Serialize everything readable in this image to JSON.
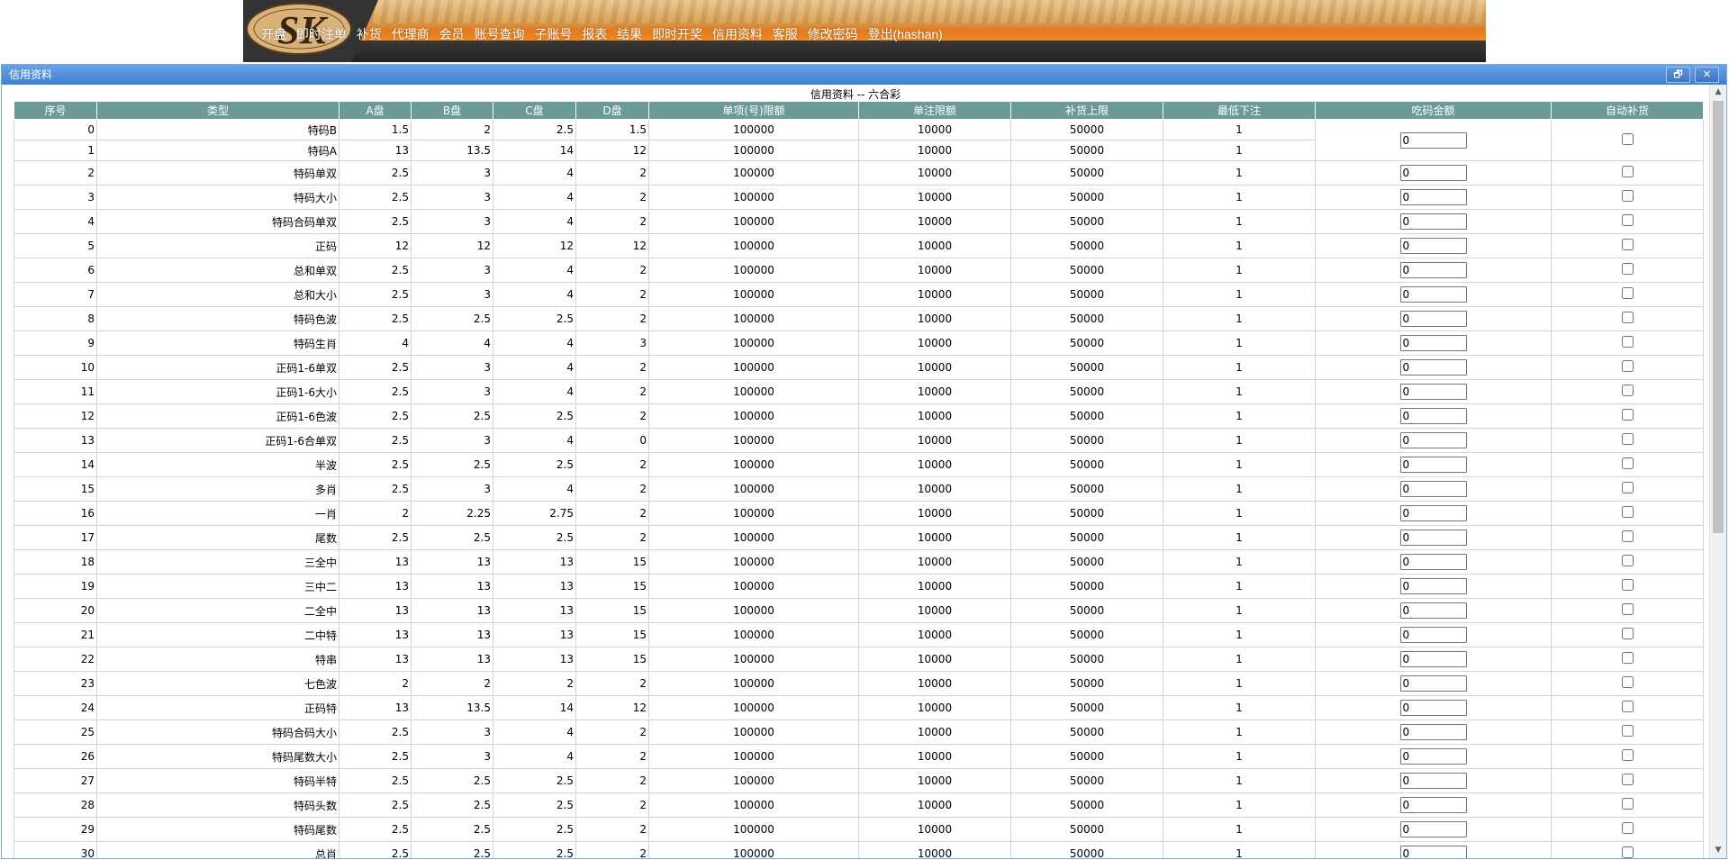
{
  "nav": {
    "logo_text": "SK",
    "items": [
      "开盘",
      "即时注单",
      "补货",
      "代理商",
      "会员",
      "账号查询",
      "子账号",
      "报表",
      "结果",
      "即时开奖",
      "信用资料",
      "客服",
      "修改密码",
      "登出(hashan)"
    ]
  },
  "window": {
    "title": "信用资料",
    "restore_symbol": "🗗",
    "close_symbol": "✕"
  },
  "page": {
    "heading": "信用资料 -- 六合彩"
  },
  "scrollbar": {
    "up_symbol": "▲",
    "down_symbol": "▼"
  },
  "table": {
    "headers": [
      "序号",
      "类型",
      "A盘",
      "B盘",
      "C盘",
      "D盘",
      "单项(号)限额",
      "单注限额",
      "补货上限",
      "最低下注",
      "吃码金额",
      "自动补货"
    ],
    "rows": [
      {
        "no": "0",
        "type": "特码B",
        "a": "1.5",
        "b": "2",
        "c": "2.5",
        "d": "1.5",
        "item_limit": "100000",
        "bet_limit": "10000",
        "hedge_limit": "50000",
        "min_bet": "1",
        "eat": "0"
      },
      {
        "no": "1",
        "type": "特码A",
        "a": "13",
        "b": "13.5",
        "c": "14",
        "d": "12",
        "item_limit": "100000",
        "bet_limit": "10000",
        "hedge_limit": "50000",
        "min_bet": "1"
      },
      {
        "no": "2",
        "type": "特码单双",
        "a": "2.5",
        "b": "3",
        "c": "4",
        "d": "2",
        "item_limit": "100000",
        "bet_limit": "10000",
        "hedge_limit": "50000",
        "min_bet": "1",
        "eat": "0"
      },
      {
        "no": "3",
        "type": "特码大小",
        "a": "2.5",
        "b": "3",
        "c": "4",
        "d": "2",
        "item_limit": "100000",
        "bet_limit": "10000",
        "hedge_limit": "50000",
        "min_bet": "1",
        "eat": "0"
      },
      {
        "no": "4",
        "type": "特码合码单双",
        "a": "2.5",
        "b": "3",
        "c": "4",
        "d": "2",
        "item_limit": "100000",
        "bet_limit": "10000",
        "hedge_limit": "50000",
        "min_bet": "1",
        "eat": "0"
      },
      {
        "no": "5",
        "type": "正码",
        "a": "12",
        "b": "12",
        "c": "12",
        "d": "12",
        "item_limit": "100000",
        "bet_limit": "10000",
        "hedge_limit": "50000",
        "min_bet": "1",
        "eat": "0"
      },
      {
        "no": "6",
        "type": "总和单双",
        "a": "2.5",
        "b": "3",
        "c": "4",
        "d": "2",
        "item_limit": "100000",
        "bet_limit": "10000",
        "hedge_limit": "50000",
        "min_bet": "1",
        "eat": "0"
      },
      {
        "no": "7",
        "type": "总和大小",
        "a": "2.5",
        "b": "3",
        "c": "4",
        "d": "2",
        "item_limit": "100000",
        "bet_limit": "10000",
        "hedge_limit": "50000",
        "min_bet": "1",
        "eat": "0"
      },
      {
        "no": "8",
        "type": "特码色波",
        "a": "2.5",
        "b": "2.5",
        "c": "2.5",
        "d": "2",
        "item_limit": "100000",
        "bet_limit": "10000",
        "hedge_limit": "50000",
        "min_bet": "1",
        "eat": "0"
      },
      {
        "no": "9",
        "type": "特码生肖",
        "a": "4",
        "b": "4",
        "c": "4",
        "d": "3",
        "item_limit": "100000",
        "bet_limit": "10000",
        "hedge_limit": "50000",
        "min_bet": "1",
        "eat": "0"
      },
      {
        "no": "10",
        "type": "正码1-6单双",
        "a": "2.5",
        "b": "3",
        "c": "4",
        "d": "2",
        "item_limit": "100000",
        "bet_limit": "10000",
        "hedge_limit": "50000",
        "min_bet": "1",
        "eat": "0"
      },
      {
        "no": "11",
        "type": "正码1-6大小",
        "a": "2.5",
        "b": "3",
        "c": "4",
        "d": "2",
        "item_limit": "100000",
        "bet_limit": "10000",
        "hedge_limit": "50000",
        "min_bet": "1",
        "eat": "0"
      },
      {
        "no": "12",
        "type": "正码1-6色波",
        "a": "2.5",
        "b": "2.5",
        "c": "2.5",
        "d": "2",
        "item_limit": "100000",
        "bet_limit": "10000",
        "hedge_limit": "50000",
        "min_bet": "1",
        "eat": "0"
      },
      {
        "no": "13",
        "type": "正码1-6合单双",
        "a": "2.5",
        "b": "3",
        "c": "4",
        "d": "0",
        "item_limit": "100000",
        "bet_limit": "10000",
        "hedge_limit": "50000",
        "min_bet": "1",
        "eat": "0"
      },
      {
        "no": "14",
        "type": "半波",
        "a": "2.5",
        "b": "2.5",
        "c": "2.5",
        "d": "2",
        "item_limit": "100000",
        "bet_limit": "10000",
        "hedge_limit": "50000",
        "min_bet": "1",
        "eat": "0"
      },
      {
        "no": "15",
        "type": "多肖",
        "a": "2.5",
        "b": "3",
        "c": "4",
        "d": "2",
        "item_limit": "100000",
        "bet_limit": "10000",
        "hedge_limit": "50000",
        "min_bet": "1",
        "eat": "0"
      },
      {
        "no": "16",
        "type": "一肖",
        "a": "2",
        "b": "2.25",
        "c": "2.75",
        "d": "2",
        "item_limit": "100000",
        "bet_limit": "10000",
        "hedge_limit": "50000",
        "min_bet": "1",
        "eat": "0"
      },
      {
        "no": "17",
        "type": "尾数",
        "a": "2.5",
        "b": "2.5",
        "c": "2.5",
        "d": "2",
        "item_limit": "100000",
        "bet_limit": "10000",
        "hedge_limit": "50000",
        "min_bet": "1",
        "eat": "0"
      },
      {
        "no": "18",
        "type": "三全中",
        "a": "13",
        "b": "13",
        "c": "13",
        "d": "15",
        "item_limit": "100000",
        "bet_limit": "10000",
        "hedge_limit": "50000",
        "min_bet": "1",
        "eat": "0"
      },
      {
        "no": "19",
        "type": "三中二",
        "a": "13",
        "b": "13",
        "c": "13",
        "d": "15",
        "item_limit": "100000",
        "bet_limit": "10000",
        "hedge_limit": "50000",
        "min_bet": "1",
        "eat": "0"
      },
      {
        "no": "20",
        "type": "二全中",
        "a": "13",
        "b": "13",
        "c": "13",
        "d": "15",
        "item_limit": "100000",
        "bet_limit": "10000",
        "hedge_limit": "50000",
        "min_bet": "1",
        "eat": "0"
      },
      {
        "no": "21",
        "type": "二中特",
        "a": "13",
        "b": "13",
        "c": "13",
        "d": "15",
        "item_limit": "100000",
        "bet_limit": "10000",
        "hedge_limit": "50000",
        "min_bet": "1",
        "eat": "0"
      },
      {
        "no": "22",
        "type": "特串",
        "a": "13",
        "b": "13",
        "c": "13",
        "d": "15",
        "item_limit": "100000",
        "bet_limit": "10000",
        "hedge_limit": "50000",
        "min_bet": "1",
        "eat": "0"
      },
      {
        "no": "23",
        "type": "七色波",
        "a": "2",
        "b": "2",
        "c": "2",
        "d": "2",
        "item_limit": "100000",
        "bet_limit": "10000",
        "hedge_limit": "50000",
        "min_bet": "1",
        "eat": "0"
      },
      {
        "no": "24",
        "type": "正码特",
        "a": "13",
        "b": "13.5",
        "c": "14",
        "d": "12",
        "item_limit": "100000",
        "bet_limit": "10000",
        "hedge_limit": "50000",
        "min_bet": "1",
        "eat": "0"
      },
      {
        "no": "25",
        "type": "特码合码大小",
        "a": "2.5",
        "b": "3",
        "c": "4",
        "d": "2",
        "item_limit": "100000",
        "bet_limit": "10000",
        "hedge_limit": "50000",
        "min_bet": "1",
        "eat": "0"
      },
      {
        "no": "26",
        "type": "特码尾数大小",
        "a": "2.5",
        "b": "3",
        "c": "4",
        "d": "2",
        "item_limit": "100000",
        "bet_limit": "10000",
        "hedge_limit": "50000",
        "min_bet": "1",
        "eat": "0"
      },
      {
        "no": "27",
        "type": "特码半特",
        "a": "2.5",
        "b": "2.5",
        "c": "2.5",
        "d": "2",
        "item_limit": "100000",
        "bet_limit": "10000",
        "hedge_limit": "50000",
        "min_bet": "1",
        "eat": "0"
      },
      {
        "no": "28",
        "type": "特码头数",
        "a": "2.5",
        "b": "2.5",
        "c": "2.5",
        "d": "2",
        "item_limit": "100000",
        "bet_limit": "10000",
        "hedge_limit": "50000",
        "min_bet": "1",
        "eat": "0"
      },
      {
        "no": "29",
        "type": "特码尾数",
        "a": "2.5",
        "b": "2.5",
        "c": "2.5",
        "d": "2",
        "item_limit": "100000",
        "bet_limit": "10000",
        "hedge_limit": "50000",
        "min_bet": "1",
        "eat": "0"
      },
      {
        "no": "30",
        "type": "总肖",
        "a": "2.5",
        "b": "2.5",
        "c": "2.5",
        "d": "2",
        "item_limit": "100000",
        "bet_limit": "10000",
        "hedge_limit": "50000",
        "min_bet": "1",
        "eat": "0"
      }
    ]
  }
}
